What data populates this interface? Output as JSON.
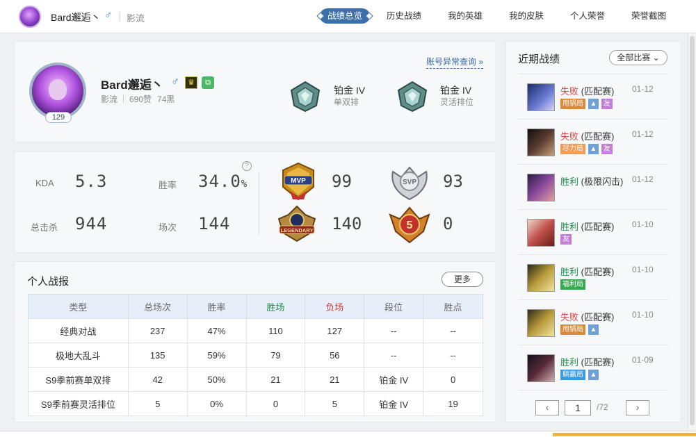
{
  "header": {
    "username": "Bard邂逅丶",
    "gender_symbol": "♂",
    "server": "影流",
    "nav": [
      "战绩总览",
      "历史战绩",
      "我的英雄",
      "我的皮肤",
      "个人荣誉",
      "荣誉截图"
    ],
    "active_nav": "战绩总览"
  },
  "profile": {
    "name": "Bard邂逅丶",
    "gender_symbol": "♂",
    "level": "129",
    "server": "影流",
    "likes": "690赞",
    "blacks": "74黑",
    "account_link": "账号异常查询 »",
    "ranks": [
      {
        "tier": "铂金 IV",
        "queue": "单双排"
      },
      {
        "tier": "铂金 IV",
        "queue": "灵活排位"
      }
    ]
  },
  "stats": {
    "kda_label": "KDA",
    "kda": "5.3",
    "winrate_label": "胜率",
    "winrate": "34.0",
    "winrate_unit": "%",
    "kills_label": "总击杀",
    "kills": "944",
    "games_label": "场次",
    "games": "144",
    "help": "?",
    "medals": [
      {
        "name": "MVP",
        "value": "99"
      },
      {
        "name": "SVP",
        "value": "93"
      },
      {
        "name": "LEGENDARY",
        "value": "140"
      },
      {
        "name": "5",
        "value": "0"
      }
    ]
  },
  "report": {
    "title": "个人战报",
    "more": "更多",
    "columns": [
      "类型",
      "总场次",
      "胜率",
      "胜场",
      "负场",
      "段位",
      "胜点"
    ],
    "rows": [
      [
        "经典对战",
        "237",
        "47%",
        "110",
        "127",
        "--",
        "--"
      ],
      [
        "极地大乱斗",
        "135",
        "59%",
        "79",
        "56",
        "--",
        "--"
      ],
      [
        "S9季前赛单双排",
        "42",
        "50%",
        "21",
        "21",
        "铂金 IV",
        "0"
      ],
      [
        "S9季前赛灵活排位",
        "5",
        "0%",
        "0",
        "5",
        "铂金 IV",
        "19"
      ]
    ]
  },
  "recent": {
    "title": "近期战绩",
    "filter": "全部比赛 ⌄",
    "items": [
      {
        "result": "失败",
        "mode": "(匹配赛)",
        "date": "01-12",
        "tags": [
          "甩锅局",
          "img",
          "友"
        ],
        "win": false
      },
      {
        "result": "失败",
        "mode": "(匹配赛)",
        "date": "01-12",
        "tags": [
          "尽力局",
          "img",
          "友"
        ],
        "win": false
      },
      {
        "result": "胜利",
        "mode": "(极限闪击)",
        "date": "01-12",
        "tags": [],
        "win": true
      },
      {
        "result": "胜利",
        "mode": "(匹配赛)",
        "date": "01-10",
        "tags": [
          "友"
        ],
        "win": true
      },
      {
        "result": "胜利",
        "mode": "(匹配赛)",
        "date": "01-10",
        "tags": [
          "福利局"
        ],
        "win": true
      },
      {
        "result": "失败",
        "mode": "(匹配赛)",
        "date": "01-10",
        "tags": [
          "甩锅局",
          "img"
        ],
        "win": false
      },
      {
        "result": "胜利",
        "mode": "(匹配赛)",
        "date": "01-09",
        "tags": [
          "躺赢局",
          "img"
        ],
        "win": true
      }
    ],
    "pager": {
      "prev": "‹",
      "current": "1",
      "total": "/72",
      "next": "›"
    }
  }
}
